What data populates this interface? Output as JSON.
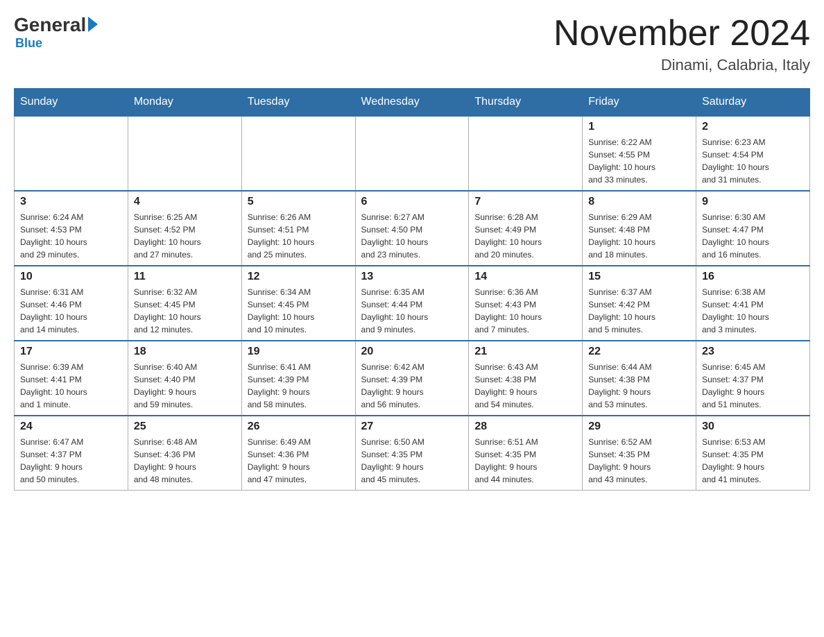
{
  "logo": {
    "general": "General",
    "arrow": "▶",
    "blue": "Blue"
  },
  "header": {
    "title": "November 2024",
    "location": "Dinami, Calabria, Italy"
  },
  "days_of_week": [
    "Sunday",
    "Monday",
    "Tuesday",
    "Wednesday",
    "Thursday",
    "Friday",
    "Saturday"
  ],
  "weeks": [
    [
      {
        "day": "",
        "info": ""
      },
      {
        "day": "",
        "info": ""
      },
      {
        "day": "",
        "info": ""
      },
      {
        "day": "",
        "info": ""
      },
      {
        "day": "",
        "info": ""
      },
      {
        "day": "1",
        "info": "Sunrise: 6:22 AM\nSunset: 4:55 PM\nDaylight: 10 hours\nand 33 minutes."
      },
      {
        "day": "2",
        "info": "Sunrise: 6:23 AM\nSunset: 4:54 PM\nDaylight: 10 hours\nand 31 minutes."
      }
    ],
    [
      {
        "day": "3",
        "info": "Sunrise: 6:24 AM\nSunset: 4:53 PM\nDaylight: 10 hours\nand 29 minutes."
      },
      {
        "day": "4",
        "info": "Sunrise: 6:25 AM\nSunset: 4:52 PM\nDaylight: 10 hours\nand 27 minutes."
      },
      {
        "day": "5",
        "info": "Sunrise: 6:26 AM\nSunset: 4:51 PM\nDaylight: 10 hours\nand 25 minutes."
      },
      {
        "day": "6",
        "info": "Sunrise: 6:27 AM\nSunset: 4:50 PM\nDaylight: 10 hours\nand 23 minutes."
      },
      {
        "day": "7",
        "info": "Sunrise: 6:28 AM\nSunset: 4:49 PM\nDaylight: 10 hours\nand 20 minutes."
      },
      {
        "day": "8",
        "info": "Sunrise: 6:29 AM\nSunset: 4:48 PM\nDaylight: 10 hours\nand 18 minutes."
      },
      {
        "day": "9",
        "info": "Sunrise: 6:30 AM\nSunset: 4:47 PM\nDaylight: 10 hours\nand 16 minutes."
      }
    ],
    [
      {
        "day": "10",
        "info": "Sunrise: 6:31 AM\nSunset: 4:46 PM\nDaylight: 10 hours\nand 14 minutes."
      },
      {
        "day": "11",
        "info": "Sunrise: 6:32 AM\nSunset: 4:45 PM\nDaylight: 10 hours\nand 12 minutes."
      },
      {
        "day": "12",
        "info": "Sunrise: 6:34 AM\nSunset: 4:45 PM\nDaylight: 10 hours\nand 10 minutes."
      },
      {
        "day": "13",
        "info": "Sunrise: 6:35 AM\nSunset: 4:44 PM\nDaylight: 10 hours\nand 9 minutes."
      },
      {
        "day": "14",
        "info": "Sunrise: 6:36 AM\nSunset: 4:43 PM\nDaylight: 10 hours\nand 7 minutes."
      },
      {
        "day": "15",
        "info": "Sunrise: 6:37 AM\nSunset: 4:42 PM\nDaylight: 10 hours\nand 5 minutes."
      },
      {
        "day": "16",
        "info": "Sunrise: 6:38 AM\nSunset: 4:41 PM\nDaylight: 10 hours\nand 3 minutes."
      }
    ],
    [
      {
        "day": "17",
        "info": "Sunrise: 6:39 AM\nSunset: 4:41 PM\nDaylight: 10 hours\nand 1 minute."
      },
      {
        "day": "18",
        "info": "Sunrise: 6:40 AM\nSunset: 4:40 PM\nDaylight: 9 hours\nand 59 minutes."
      },
      {
        "day": "19",
        "info": "Sunrise: 6:41 AM\nSunset: 4:39 PM\nDaylight: 9 hours\nand 58 minutes."
      },
      {
        "day": "20",
        "info": "Sunrise: 6:42 AM\nSunset: 4:39 PM\nDaylight: 9 hours\nand 56 minutes."
      },
      {
        "day": "21",
        "info": "Sunrise: 6:43 AM\nSunset: 4:38 PM\nDaylight: 9 hours\nand 54 minutes."
      },
      {
        "day": "22",
        "info": "Sunrise: 6:44 AM\nSunset: 4:38 PM\nDaylight: 9 hours\nand 53 minutes."
      },
      {
        "day": "23",
        "info": "Sunrise: 6:45 AM\nSunset: 4:37 PM\nDaylight: 9 hours\nand 51 minutes."
      }
    ],
    [
      {
        "day": "24",
        "info": "Sunrise: 6:47 AM\nSunset: 4:37 PM\nDaylight: 9 hours\nand 50 minutes."
      },
      {
        "day": "25",
        "info": "Sunrise: 6:48 AM\nSunset: 4:36 PM\nDaylight: 9 hours\nand 48 minutes."
      },
      {
        "day": "26",
        "info": "Sunrise: 6:49 AM\nSunset: 4:36 PM\nDaylight: 9 hours\nand 47 minutes."
      },
      {
        "day": "27",
        "info": "Sunrise: 6:50 AM\nSunset: 4:35 PM\nDaylight: 9 hours\nand 45 minutes."
      },
      {
        "day": "28",
        "info": "Sunrise: 6:51 AM\nSunset: 4:35 PM\nDaylight: 9 hours\nand 44 minutes."
      },
      {
        "day": "29",
        "info": "Sunrise: 6:52 AM\nSunset: 4:35 PM\nDaylight: 9 hours\nand 43 minutes."
      },
      {
        "day": "30",
        "info": "Sunrise: 6:53 AM\nSunset: 4:35 PM\nDaylight: 9 hours\nand 41 minutes."
      }
    ]
  ]
}
